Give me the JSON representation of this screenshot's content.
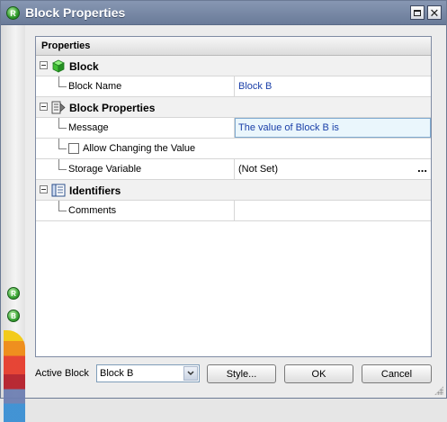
{
  "window": {
    "title": "Block Properties",
    "app_icon_letter": "R"
  },
  "sidebar": {
    "icons": [
      {
        "name": "reliability-icon",
        "letter": "R"
      },
      {
        "name": "block-icon",
        "letter": "B"
      }
    ]
  },
  "grid": {
    "header": "Properties",
    "categories": [
      {
        "label": "Block",
        "icon": "cube-icon",
        "properties": [
          {
            "label": "Block Name",
            "value": "Block B"
          }
        ]
      },
      {
        "label": "Block Properties",
        "icon": "block-properties-icon",
        "properties": [
          {
            "label": "Message",
            "value": "The value of Block B is"
          },
          {
            "label": "Allow Changing the Value",
            "checked": false
          },
          {
            "label": "Storage Variable",
            "value": "(Not Set)",
            "button": "..."
          }
        ]
      },
      {
        "label": "Identifiers",
        "icon": "identifiers-icon",
        "properties": [
          {
            "label": "Comments",
            "value": ""
          }
        ]
      }
    ]
  },
  "footer": {
    "active_block_label": "Active Block",
    "active_block_value": "Block B",
    "style_button": "Style...",
    "ok_button": "OK",
    "cancel_button": "Cancel"
  },
  "colors": {
    "titlebar": "#7888a6",
    "value_text": "#1a3fa8",
    "selected_value_bg": "#eaf6fc"
  }
}
